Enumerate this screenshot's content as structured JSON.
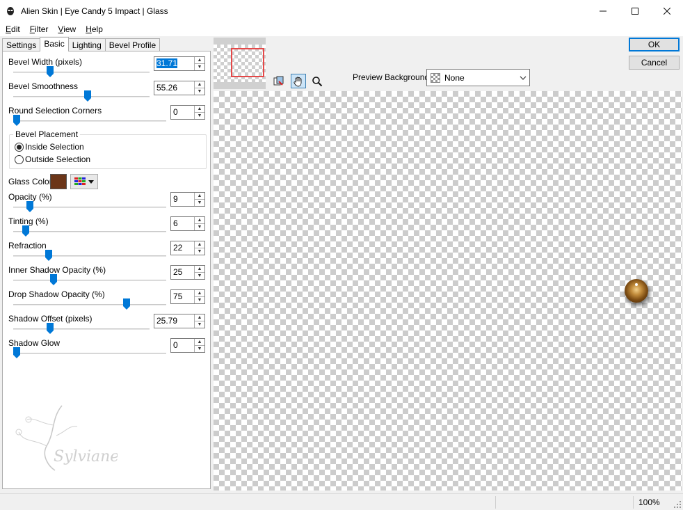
{
  "window": {
    "title": "Alien Skin | Eye Candy 5 Impact | Glass",
    "controls": {
      "minimize": "—",
      "maximize": "☐",
      "close": "✕"
    }
  },
  "menu": [
    {
      "accel": "E",
      "rest": "dit"
    },
    {
      "accel": "F",
      "rest": "ilter"
    },
    {
      "accel": "V",
      "rest": "iew"
    },
    {
      "accel": "H",
      "rest": "elp"
    }
  ],
  "tabs": [
    "Settings",
    "Basic",
    "Lighting",
    "Bevel Profile"
  ],
  "active_tab": "Basic",
  "controls": {
    "bevel_width": {
      "label": "Bevel Width (pixels)",
      "value": "31.71",
      "fraction": 0.26
    },
    "bevel_smoothness": {
      "label": "Bevel Smoothness",
      "value": "55.26",
      "fraction": 0.55
    },
    "round_corners": {
      "label": "Round Selection Corners",
      "value": "0",
      "fraction": 0.0
    },
    "bevel_placement": {
      "label": "Bevel Placement",
      "options": [
        "Inside Selection",
        "Outside Selection"
      ],
      "selected": "Inside Selection"
    },
    "glass_color": {
      "label": "Glass Color",
      "color": "#6b3518"
    },
    "opacity": {
      "label": "Opacity (%)",
      "value": "9",
      "fraction": 0.09
    },
    "tinting": {
      "label": "Tinting (%)",
      "value": "6",
      "fraction": 0.06
    },
    "refraction": {
      "label": "Refraction",
      "value": "22",
      "fraction": 0.22
    },
    "inner_shadow": {
      "label": "Inner Shadow Opacity (%)",
      "value": "25",
      "fraction": 0.25
    },
    "drop_shadow": {
      "label": "Drop Shadow Opacity (%)",
      "value": "75",
      "fraction": 0.75
    },
    "shadow_offset": {
      "label": "Shadow Offset (pixels)",
      "value": "25.79",
      "fraction": 0.26
    },
    "shadow_glow": {
      "label": "Shadow Glow",
      "value": "0",
      "fraction": 0.0
    }
  },
  "watermark": {
    "text": "Sylviane"
  },
  "preview_background": {
    "label": "Preview Background:",
    "value": "None"
  },
  "buttons": {
    "ok": "OK",
    "cancel": "Cancel"
  },
  "status": {
    "zoom": "100%"
  },
  "colors": {
    "accent": "#0078d7",
    "nav_rect": "#e54848"
  }
}
